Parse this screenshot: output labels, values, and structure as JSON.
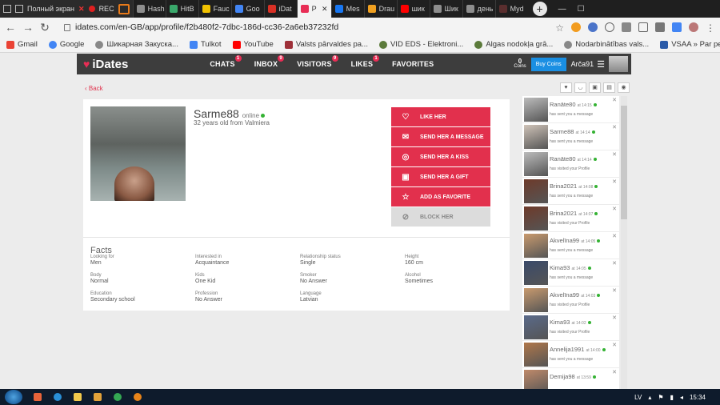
{
  "recorder": {
    "fullscreen_label": "Полный экран",
    "rec_label": "REC"
  },
  "tabs": [
    {
      "label": "Hash",
      "color": "#8e8e8e"
    },
    {
      "label": "HitB",
      "color": "#3aa86b"
    },
    {
      "label": "Fauc",
      "color": "#f2c200"
    },
    {
      "label": "Goo",
      "color": "#4285f4"
    },
    {
      "label": "iDat",
      "color": "#d93025"
    },
    {
      "label": "P",
      "color": "#e82d55",
      "active": true
    },
    {
      "label": "Mes",
      "color": "#1877f2"
    },
    {
      "label": "Drau",
      "color": "#f0a020"
    },
    {
      "label": "шик",
      "color": "#ff0000"
    },
    {
      "label": "Шик",
      "color": "#8e8e8e"
    },
    {
      "label": "день",
      "color": "#8e8e8e"
    },
    {
      "label": "Myd",
      "color": "#5a2e2e"
    }
  ],
  "address": {
    "url": "idates.com/en-GB/app/profile/f2b480f2-7dbc-186d-cc36-2a6eb37232fd"
  },
  "bookmarks": [
    "Gmail",
    "Google",
    "Шикарная Закуска...",
    "Tulkot",
    "YouTube",
    "Valsts pārvaldes pa...",
    "VID EDS - Elektroni...",
    "Algas nodokļa grā...",
    "Nodarbinātības vals...",
    "VSAA » Par pensiju..."
  ],
  "header": {
    "logo": "iDates",
    "nav": [
      {
        "label": "CHATS",
        "badge": "1"
      },
      {
        "label": "INBOX",
        "badge": "9"
      },
      {
        "label": "VISITORS",
        "badge": "9"
      },
      {
        "label": "LIKES",
        "badge": "1"
      },
      {
        "label": "FAVORITES",
        "badge": ""
      }
    ],
    "coins_value": "0",
    "coins_label": "Coins",
    "buy_label": "Buy Coins",
    "username": "Arča91"
  },
  "back_label": "Back",
  "profile": {
    "name": "Sarme88",
    "status": "online",
    "subtitle": "32 years old from Valmiera"
  },
  "actions": [
    {
      "label": "LIKE HER",
      "icon": "heart-icon",
      "glyph": "♡"
    },
    {
      "label": "SEND HER A MESSAGE",
      "icon": "message-icon",
      "glyph": "✉"
    },
    {
      "label": "SEND HER A KISS",
      "icon": "kiss-icon",
      "glyph": "◎"
    },
    {
      "label": "SEND HER A GIFT",
      "icon": "gift-icon",
      "glyph": "▣"
    },
    {
      "label": "ADD AS FAVORITE",
      "icon": "star-icon",
      "glyph": "☆"
    },
    {
      "label": "BLOCK HER",
      "icon": "block-icon",
      "glyph": "⊘"
    }
  ],
  "facts": {
    "title": "Facts",
    "items": [
      {
        "label": "Looking for",
        "value": "Men"
      },
      {
        "label": "Interested in",
        "value": "Acquaintance"
      },
      {
        "label": "Relationship status",
        "value": "Single"
      },
      {
        "label": "Height",
        "value": "160 cm"
      },
      {
        "label": "Body",
        "value": "Normal"
      },
      {
        "label": "Kids",
        "value": "One Kid"
      },
      {
        "label": "Smoker",
        "value": "No Answer"
      },
      {
        "label": "Alcohol",
        "value": "Sometimes"
      },
      {
        "label": "Education",
        "value": "Secondary school"
      },
      {
        "label": "Profession",
        "value": "No Answer"
      },
      {
        "label": "Language",
        "value": "Latvian"
      }
    ]
  },
  "notifications": [
    {
      "name": "Ranāte80",
      "time": "at 14:15",
      "text": "has sent you a message"
    },
    {
      "name": "Sarme88",
      "time": "at 14:14",
      "text": "has sent you a message"
    },
    {
      "name": "Ranāte80",
      "time": "at 14:14",
      "text": "has visited your Profile"
    },
    {
      "name": "Brina2021",
      "time": "at 14:08",
      "text": "has sent you a message"
    },
    {
      "name": "Brina2021",
      "time": "at 14:07",
      "text": "has visited your Profile"
    },
    {
      "name": "Akvelīna99",
      "time": "at 14:05",
      "text": "has sent you a message"
    },
    {
      "name": "Kima93",
      "time": "at 14:05",
      "text": "has sent you a message"
    },
    {
      "name": "Akvelīna99",
      "time": "at 14:03",
      "text": "has visited your Profile"
    },
    {
      "name": "Kima93",
      "time": "at 14:02",
      "text": "has visited your Profile"
    },
    {
      "name": "Annelija1991",
      "time": "at 14:00",
      "text": "has sent you a message"
    },
    {
      "name": "Demija98",
      "time": "at 13:59",
      "text": ""
    }
  ],
  "taskbar": {
    "lang": "LV",
    "clock": "15:34"
  }
}
